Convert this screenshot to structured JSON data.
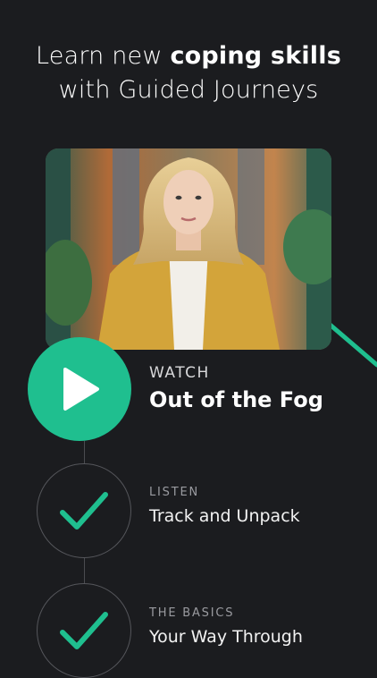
{
  "header": {
    "line1_prefix": "Learn new ",
    "line1_bold": "coping skills",
    "line2": "with Guided Journeys"
  },
  "colors": {
    "accent": "#1fbf8f",
    "background": "#1b1c1f"
  },
  "video": {
    "thumbnail": "woman-in-mustard-blazer"
  },
  "steps": [
    {
      "category": "WATCH",
      "title": "Out of the Fog",
      "icon": "play-icon",
      "state": "current"
    },
    {
      "category": "LISTEN",
      "title": "Track and Unpack",
      "icon": "check-icon",
      "state": "completed"
    },
    {
      "category": "THE BASICS",
      "title": "Your Way Through",
      "icon": "check-icon",
      "state": "completed"
    }
  ]
}
